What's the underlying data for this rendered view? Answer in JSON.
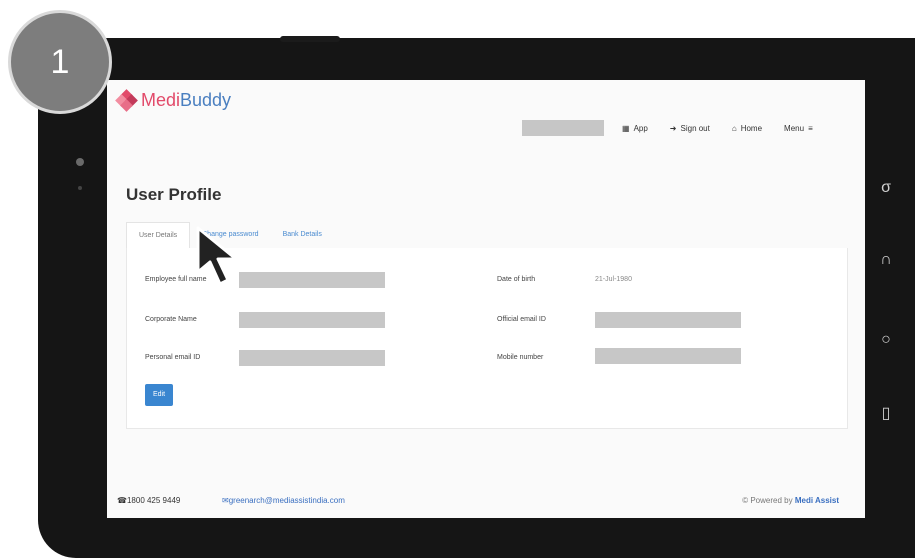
{
  "step_badge": "1",
  "logo": {
    "part1": "Medi",
    "part2": "Buddy"
  },
  "nav": {
    "search_placeholder": "",
    "items": [
      {
        "label": "App",
        "icon": "grid-icon"
      },
      {
        "label": "Sign out",
        "icon": "sign-out-icon"
      },
      {
        "label": "Home",
        "icon": "home-icon"
      },
      {
        "label": "Menu",
        "icon": "hamburger-icon"
      }
    ]
  },
  "page_title": "User Profile",
  "tabs": [
    {
      "label": "User Details",
      "active": true
    },
    {
      "label": "Change password",
      "active": false
    },
    {
      "label": "Bank Details",
      "active": false
    }
  ],
  "fields": {
    "employee_full_name": {
      "label": "Employee full name",
      "value": ""
    },
    "corporate_name": {
      "label": "Corporate Name",
      "value": ""
    },
    "personal_email": {
      "label": "Personal email ID",
      "value": ""
    },
    "date_of_birth": {
      "label": "Date of birth",
      "value": "21-Jul-1980"
    },
    "official_email": {
      "label": "Official email ID",
      "value": ""
    },
    "mobile_number": {
      "label": "Mobile number",
      "value": ""
    }
  },
  "edit_label": "Edit",
  "footer": {
    "phone": "☎1800 425 9449",
    "email": "✉greenarch@mediassistindia.com",
    "powered_prefix": "© Powered by",
    "powered_brand": "Medi Assist"
  },
  "colors": {
    "brand_blue": "#4a7fc0",
    "brand_pink": "#e24a6a",
    "edit_button": "#3a86d0",
    "link": "#4a8bd0"
  }
}
